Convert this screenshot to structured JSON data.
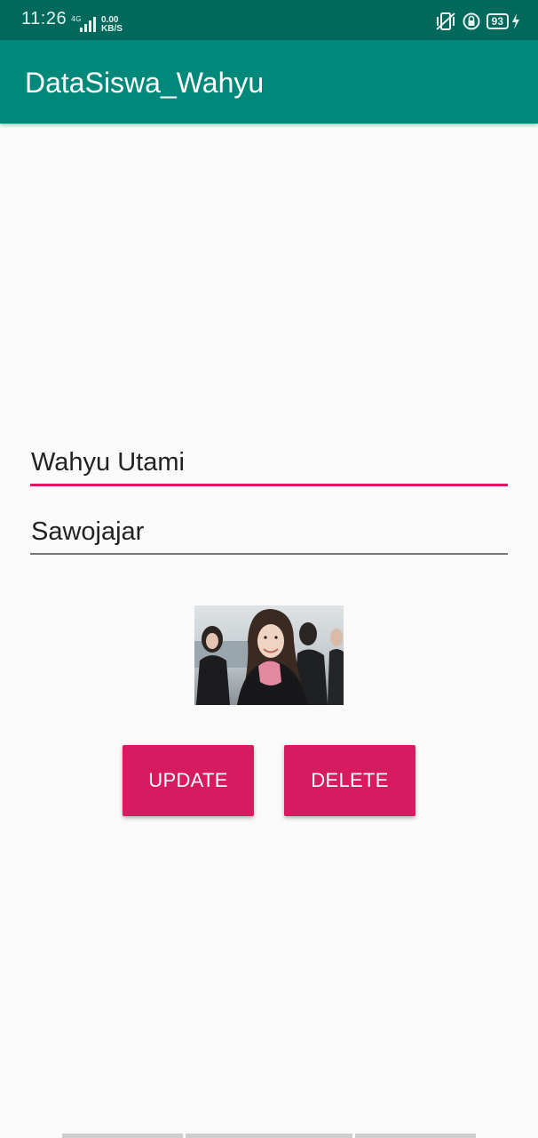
{
  "status_bar": {
    "time": "11:26",
    "network_label": "4G",
    "speed_value": "0.00",
    "speed_unit": "KB/S",
    "battery_level": "93",
    "icons": [
      "vibrate-icon",
      "rotation-lock-icon",
      "battery-icon",
      "charging-icon"
    ]
  },
  "app_bar": {
    "title": "DataSiswa_Wahyu"
  },
  "form": {
    "name_value": "Wahyu Utami",
    "address_value": "Sawojajar"
  },
  "buttons": {
    "update_label": "UPDATE",
    "delete_label": "DELETE"
  },
  "colors": {
    "status_bar": "#00695c",
    "app_bar": "#00897b",
    "accent": "#d81b60",
    "background": "#fafafa"
  }
}
